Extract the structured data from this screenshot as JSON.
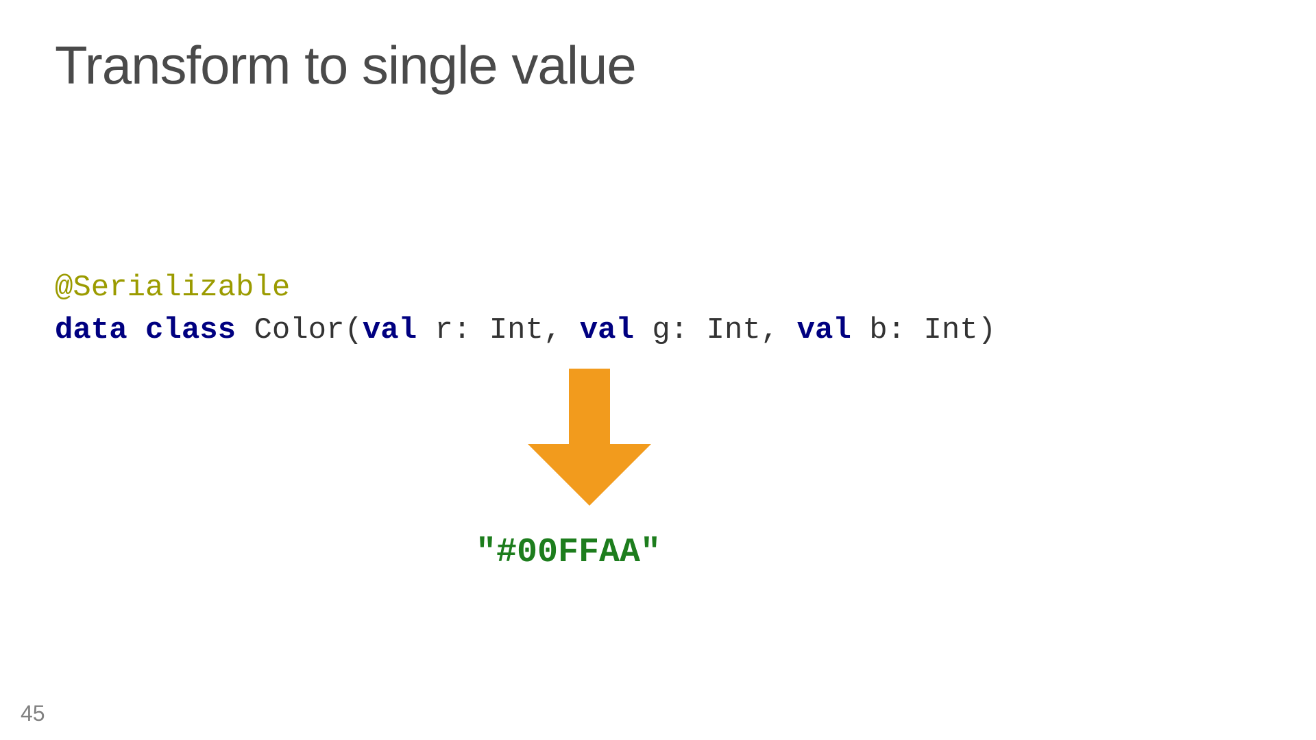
{
  "title": "Transform to single value",
  "code": {
    "annotation": "@Serializable",
    "line2": {
      "kw_data": "data",
      "kw_class": "class",
      "name": " Color(",
      "kw_val1": "val",
      "param_r": " r: Int, ",
      "kw_val2": "val",
      "param_g": " g: Int, ",
      "kw_val3": "val",
      "param_b": " b: Int)"
    }
  },
  "result": "\"#00FFAA\"",
  "pageNumber": "45",
  "colors": {
    "arrow": "#f29b1d",
    "keyword": "#000080",
    "annotation": "#9b9b00",
    "result": "#1d7d1d"
  }
}
